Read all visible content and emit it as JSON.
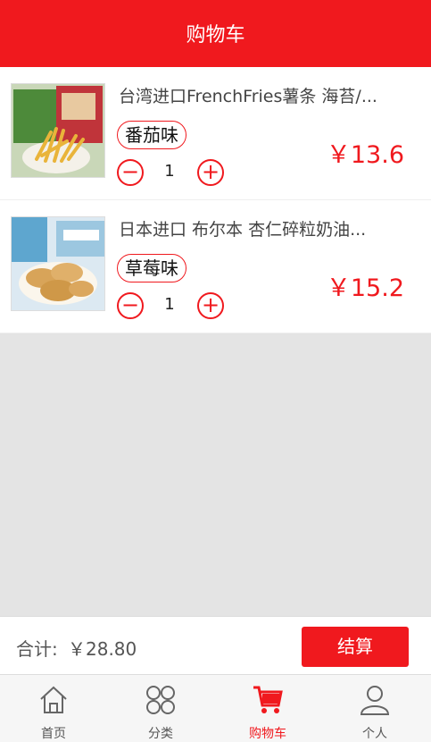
{
  "header": {
    "title": "购物车"
  },
  "cart": {
    "items": [
      {
        "name": "台湾进口FrenchFries薯条 海苔/...",
        "flavor": "番茄味",
        "price": "￥13.6",
        "quantity": "1",
        "image_icon": "fries-product-photo"
      },
      {
        "name": "日本进口 布尔本 杏仁碎粒奶油...",
        "flavor": "草莓味",
        "price": "￥15.2",
        "quantity": "1",
        "image_icon": "biscuit-product-photo"
      }
    ],
    "minus_symbol": "−",
    "plus_symbol": "+"
  },
  "summary": {
    "total_label": "合计:",
    "total_value": "￥28.80",
    "checkout_label": "结算"
  },
  "tabbar": {
    "tabs": [
      {
        "label": "首页",
        "icon": "home-icon"
      },
      {
        "label": "分类",
        "icon": "category-grid-icon"
      },
      {
        "label": "购物车",
        "icon": "cart-icon",
        "active": true
      },
      {
        "label": "个人",
        "icon": "user-icon"
      }
    ]
  },
  "colors": {
    "accent": "#f0191e",
    "background": "#e4e4e4"
  }
}
